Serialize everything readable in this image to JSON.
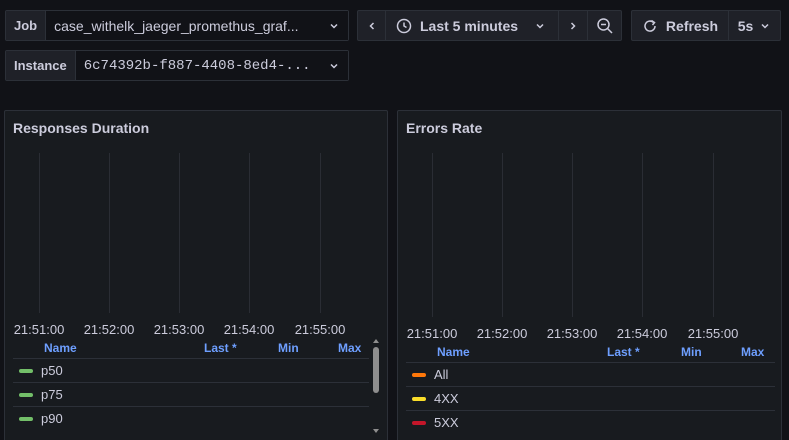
{
  "variables": {
    "job": {
      "label": "Job",
      "value": "case_withelk_jaeger_promethus_graf..."
    },
    "instance": {
      "label": "Instance",
      "value": "6c74392b-f887-4408-8ed4-..."
    }
  },
  "toolbar": {
    "time_range": "Last 5 minutes",
    "refresh_label": "Refresh",
    "refresh_interval": "5s"
  },
  "panels": [
    {
      "title": "Responses Duration",
      "x_ticks": [
        "21:51:00",
        "21:52:00",
        "21:53:00",
        "21:54:00",
        "21:55:00"
      ],
      "legend_headers": {
        "name": "Name",
        "last": "Last *",
        "min": "Min",
        "max": "Max"
      },
      "series": [
        {
          "name": "p50",
          "color": "#73bf69"
        },
        {
          "name": "p75",
          "color": "#73bf69"
        },
        {
          "name": "p90",
          "color": "#73bf69"
        }
      ]
    },
    {
      "title": "Errors Rate",
      "x_ticks": [
        "21:51:00",
        "21:52:00",
        "21:53:00",
        "21:54:00",
        "21:55:00"
      ],
      "legend_headers": {
        "name": "Name",
        "last": "Last *",
        "min": "Min",
        "max": "Max"
      },
      "series": [
        {
          "name": "All",
          "color": "#ff780a"
        },
        {
          "name": "4XX",
          "color": "#fade2a"
        },
        {
          "name": "5XX",
          "color": "#c4162a"
        }
      ]
    }
  ],
  "chart_data": [
    {
      "type": "line",
      "title": "Responses Duration",
      "x": [
        "21:51:00",
        "21:52:00",
        "21:53:00",
        "21:54:00",
        "21:55:00"
      ],
      "series": [
        {
          "name": "p50",
          "values": []
        },
        {
          "name": "p75",
          "values": []
        },
        {
          "name": "p90",
          "values": []
        }
      ],
      "grid": true,
      "legend": "bottom"
    },
    {
      "type": "line",
      "title": "Errors Rate",
      "x": [
        "21:51:00",
        "21:52:00",
        "21:53:00",
        "21:54:00",
        "21:55:00"
      ],
      "series": [
        {
          "name": "All",
          "values": []
        },
        {
          "name": "4XX",
          "values": []
        },
        {
          "name": "5XX",
          "values": []
        }
      ],
      "grid": true,
      "legend": "bottom"
    }
  ]
}
